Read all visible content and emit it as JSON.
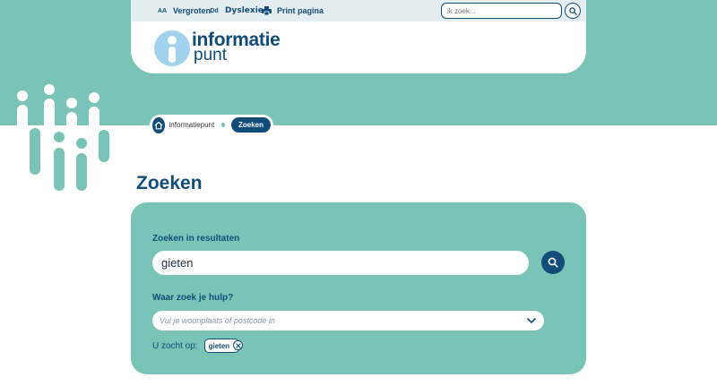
{
  "toolbar": {
    "enlarge_icon": "AA",
    "enlarge_label": "Vergroten",
    "dyslexia_icon": "Dd",
    "dyslexia_label": "Dyslexie",
    "print_icon": "printer-icon",
    "print_label": "Print pagina",
    "search_placeholder": "ik zoek..."
  },
  "logo": {
    "line1": "informatie",
    "line2": "punt"
  },
  "breadcrumb": {
    "home_label": "informatiepunt",
    "current": "Zoeken"
  },
  "page": {
    "title": "Zoeken"
  },
  "search": {
    "results_label": "Zoeken in resultaten",
    "query_value": "gieten",
    "location_label": "Waar zoek je hulp?",
    "location_placeholder": "Vul je woonplaats of postcode in",
    "you_searched_label": "U zocht op:",
    "chip_value": "gieten"
  },
  "colors": {
    "primary": "#124c78",
    "teal": "#79c4b6",
    "topbar": "#e4eef2",
    "logo_light": "#a3d2ee"
  }
}
